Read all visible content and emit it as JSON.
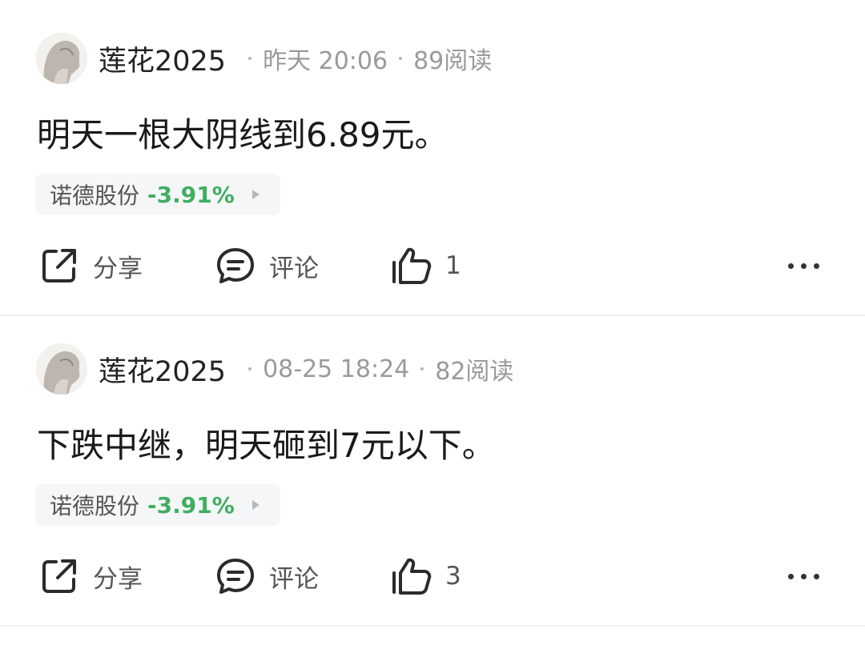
{
  "posts": [
    {
      "username": "莲花2025",
      "time": "昨天 20:06",
      "reads": "89阅读",
      "content": "明天一根大阴线到6.89元。",
      "stock": {
        "name": "诺德股份",
        "change": "-3.91%"
      },
      "actions": {
        "share": "分享",
        "comment": "评论",
        "likes": "1"
      }
    },
    {
      "username": "莲花2025",
      "time": "08-25 18:24",
      "reads": "82阅读",
      "content": "下跌中继，明天砸到7元以下。",
      "stock": {
        "name": "诺德股份",
        "change": "-3.91%"
      },
      "actions": {
        "share": "分享",
        "comment": "评论",
        "likes": "3"
      }
    }
  ],
  "colors": {
    "stock_change": "#3fae62",
    "divider": "#eeeeee",
    "tag_bg": "#f5f6f8"
  },
  "icons": [
    "share-icon",
    "comment-icon",
    "like-icon",
    "more-icon"
  ]
}
